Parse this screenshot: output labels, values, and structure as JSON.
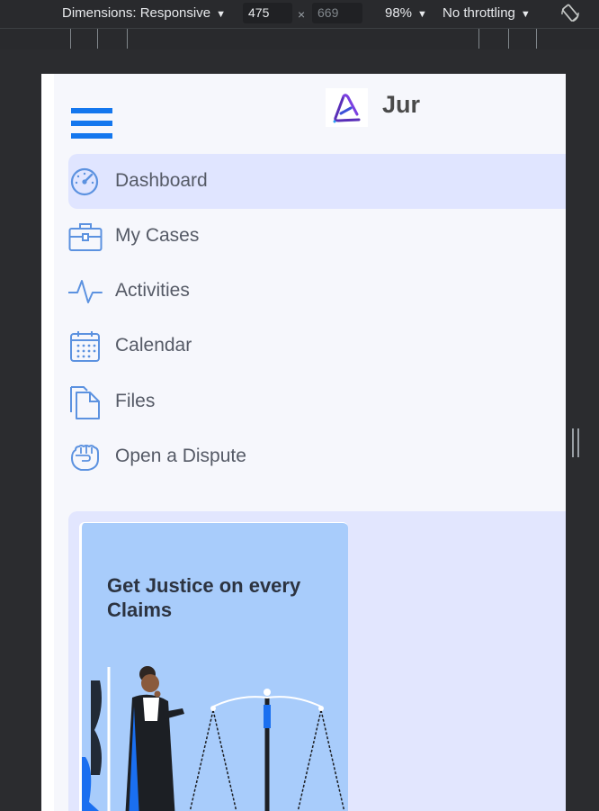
{
  "devtools": {
    "dimensions_label": "Dimensions: Responsive",
    "width_value": "475",
    "height_value": "669",
    "times_sign": "×",
    "zoom": "98%",
    "throttling": "No throttling",
    "caret": "▼"
  },
  "app": {
    "brand_name": "Jur",
    "accent_color": "#1477ee",
    "active_bg": "#e0e5ff"
  },
  "nav": {
    "items": [
      {
        "label": "Dashboard",
        "icon": "speedometer-icon",
        "active": true
      },
      {
        "label": "My Cases",
        "icon": "briefcase-icon",
        "active": false
      },
      {
        "label": "Activities",
        "icon": "pulse-icon",
        "active": false
      },
      {
        "label": "Calendar",
        "icon": "calendar-icon",
        "active": false
      },
      {
        "label": "Files",
        "icon": "files-icon",
        "active": false
      },
      {
        "label": "Open a Dispute",
        "icon": "fist-icon",
        "active": false
      }
    ]
  },
  "promo": {
    "title": "Get Justice on every Claims",
    "illustration": "judge-and-scales-illustration"
  }
}
